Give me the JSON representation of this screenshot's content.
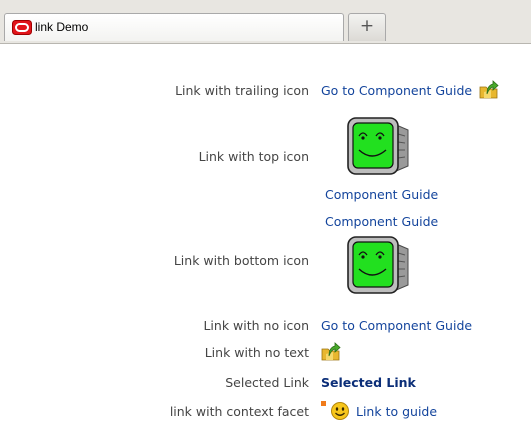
{
  "tab": {
    "title": "link Demo",
    "new_tab_label": "+"
  },
  "rows": [
    {
      "label": "Link with trailing icon",
      "link_text": "Go to Component Guide",
      "icon": "folder-arrow-icon"
    },
    {
      "label": "Link with top icon",
      "link_text": "Component Guide",
      "icon": "smiley-monitor-icon"
    },
    {
      "label": "Link with bottom icon",
      "link_text": "Component Guide",
      "icon": "smiley-monitor-icon"
    },
    {
      "label": "Link with no icon",
      "link_text": "Go to Component Guide"
    },
    {
      "label": "Link with no text",
      "icon": "folder-arrow-icon"
    },
    {
      "label": "Selected Link",
      "link_text": "Selected Link"
    },
    {
      "label": "link with context facet",
      "link_text": "Link to guide",
      "icon": "smiley-face-icon"
    }
  ],
  "colors": {
    "link": "#13449c",
    "selected_link": "#0b2e78",
    "label": "#454545",
    "monitor_screen": "#22e01f"
  }
}
